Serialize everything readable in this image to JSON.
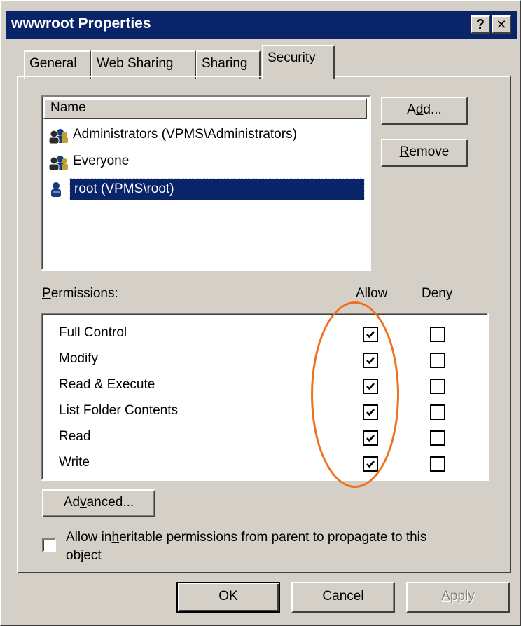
{
  "window": {
    "title": "wwwroot Properties",
    "help_button": "?",
    "close_button": "✕"
  },
  "tabs": [
    {
      "label": "General"
    },
    {
      "label": "Web Sharing"
    },
    {
      "label": "Sharing"
    },
    {
      "label": "Security",
      "active": true
    }
  ],
  "users_list": {
    "column_header": "Name",
    "items": [
      {
        "label": "Administrators (VPMS\\Administrators)",
        "icon": "group-icon"
      },
      {
        "label": "Everyone",
        "icon": "group-icon"
      },
      {
        "label": "root (VPMS\\root)",
        "icon": "user-icon",
        "selected": true
      }
    ]
  },
  "buttons": {
    "add": {
      "pre": "A",
      "mn": "d",
      "post": "d..."
    },
    "remove": {
      "pre": "",
      "mn": "R",
      "post": "emove"
    },
    "advanced": {
      "pre": "Ad",
      "mn": "v",
      "post": "anced..."
    },
    "ok": "OK",
    "cancel": "Cancel",
    "apply": {
      "pre": "",
      "mn": "A",
      "post": "pply",
      "disabled": true
    }
  },
  "permissions": {
    "label_mn": "P",
    "label_rest": "ermissions:",
    "allow_header": "Allow",
    "deny_header": "Deny",
    "rows": [
      {
        "name": "Full Control",
        "allow": true,
        "deny": false
      },
      {
        "name": "Modify",
        "allow": true,
        "deny": false
      },
      {
        "name": "Read & Execute",
        "allow": true,
        "deny": false
      },
      {
        "name": "List Folder Contents",
        "allow": true,
        "deny": false
      },
      {
        "name": "Read",
        "allow": true,
        "deny": false
      },
      {
        "name": "Write",
        "allow": true,
        "deny": false
      }
    ]
  },
  "inherit": {
    "line1_pre": "Allow in",
    "line1_mn": "h",
    "line1_post": "eritable permissions from parent to propagate to this",
    "line2": "object",
    "checked": false
  },
  "colors": {
    "titlebar": "#0a246a",
    "dialog_face": "#d4d0c8",
    "highlight_ellipse": "#f07020"
  }
}
